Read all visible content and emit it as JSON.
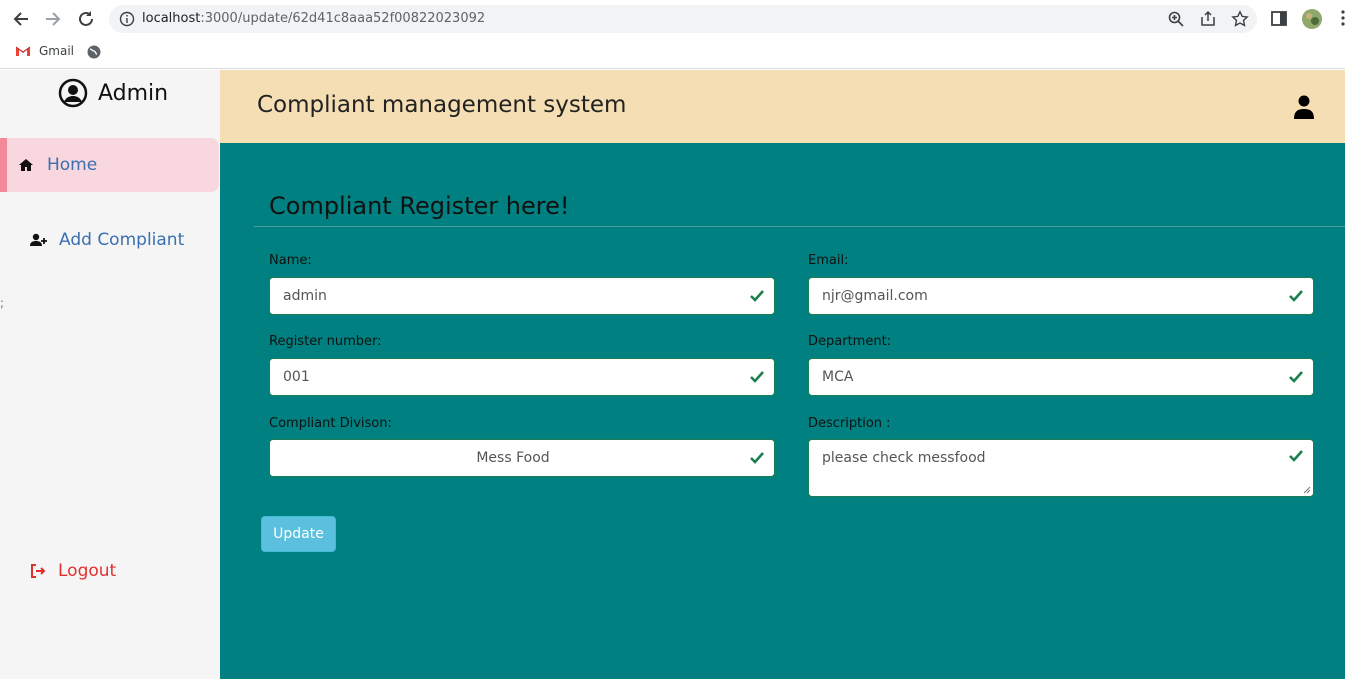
{
  "browser": {
    "url_host": "localhost",
    "url_rest": ":3000/update/62d41c8aaa52f00822023092",
    "bookmark_gmail": "Gmail"
  },
  "sidebar": {
    "brand": "Admin",
    "home": "Home",
    "add_compliant": "Add Compliant",
    "logout": "Logout",
    "stray_char": ";"
  },
  "header": {
    "title": "Compliant management system"
  },
  "form": {
    "heading": "Compliant Register here!",
    "name_label": "Name:",
    "name_value": "admin",
    "email_label": "Email:",
    "email_value": "njr@gmail.com",
    "regno_label": "Register number:",
    "regno_value": "001",
    "dept_label": "Department:",
    "dept_value": "MCA",
    "division_label": "Compliant Divison:",
    "division_value": "Mess Food",
    "desc_label": "Description :",
    "desc_value": "please check messfood",
    "update_label": "Update"
  },
  "colors": {
    "teal": "#008080",
    "header_bg": "#f5deb3",
    "active_nav_bg": "#f8d7de",
    "valid_green": "#1e7f4e",
    "update_btn": "#5bc0de",
    "logout_red": "#e0302e"
  }
}
